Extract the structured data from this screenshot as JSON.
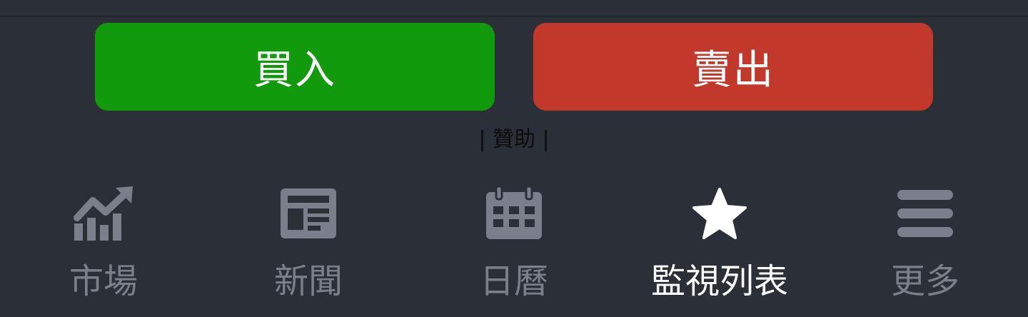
{
  "trade": {
    "buy_label": "買入",
    "sell_label": "賣出",
    "buy_color": "#129a0d",
    "sell_color": "#c2392c"
  },
  "sponsor": {
    "text": "| 贊助 |"
  },
  "tabs": [
    {
      "label": "市場",
      "icon": "chart-trend-icon",
      "active": false
    },
    {
      "label": "新聞",
      "icon": "newspaper-icon",
      "active": false
    },
    {
      "label": "日曆",
      "icon": "calendar-icon",
      "active": false
    },
    {
      "label": "監視列表",
      "icon": "star-icon",
      "active": true
    },
    {
      "label": "更多",
      "icon": "menu-icon",
      "active": false
    }
  ],
  "colors": {
    "background": "#2b2f38",
    "inactive": "#7a7f8b",
    "active": "#ffffff"
  }
}
